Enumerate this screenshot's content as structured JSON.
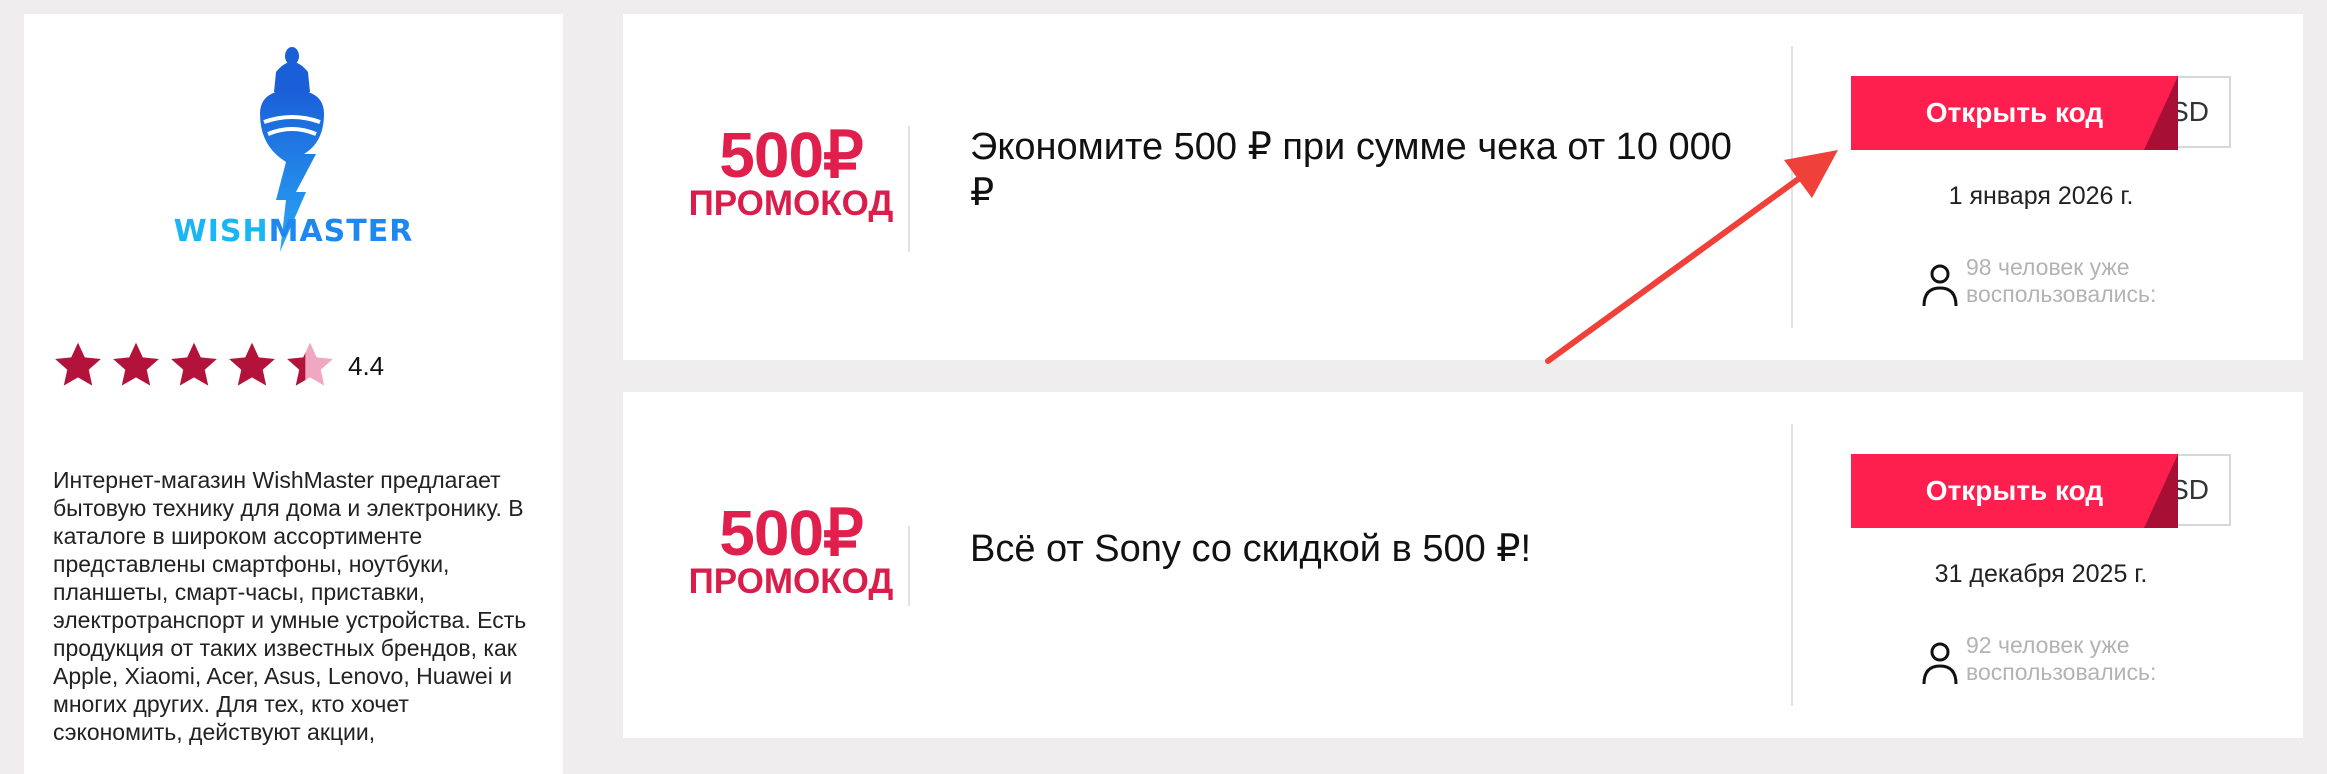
{
  "store": {
    "logo_text_part1": "WISH",
    "logo_text_part2": "MASTER",
    "rating_value": "4.4",
    "rating": 4.4,
    "rating_max": 5,
    "description": "Интернет-магазин WishMaster предлагает бытовую технику для дома и электронику. В каталоге в широком ассортименте представлены смартфоны, ноутбуки, планшеты, смарт-часы, приставки, электротранспорт и умные устройства. Есть продукция от таких известных брендов, как Apple, Xiaomi, Acer, Asus, Lenovo, Huawei и многих других. Для тех, кто хочет сэкономить, действуют акции,"
  },
  "coupons": [
    {
      "amount": "500₽",
      "type": "ПРОМОКОД",
      "title": "Экономите 500 ₽ при сумме чека от 10 000 ₽",
      "code_peek": "SD",
      "button_label": "Открыть код",
      "expires": "1 января 2026 г.",
      "used_text": "98 человек уже воспользовались:"
    },
    {
      "amount": "500₽",
      "type": "ПРОМОКОД",
      "title": "Всё от Sony со скидкой в 500 ₽!",
      "code_peek": "SD",
      "button_label": "Открыть код",
      "expires": "31 декабря 2025 г.",
      "used_text": "92 человек уже воспользовались:"
    }
  ],
  "colors": {
    "accent": "#ff1f4f",
    "promo_red": "#e01f4c",
    "star": "#b3123a",
    "star_empty": "#f0a8c0",
    "arrow": "#f0403a"
  },
  "icons": [
    "genie-logo-icon",
    "star-icon",
    "user-icon",
    "annotation-arrow"
  ]
}
